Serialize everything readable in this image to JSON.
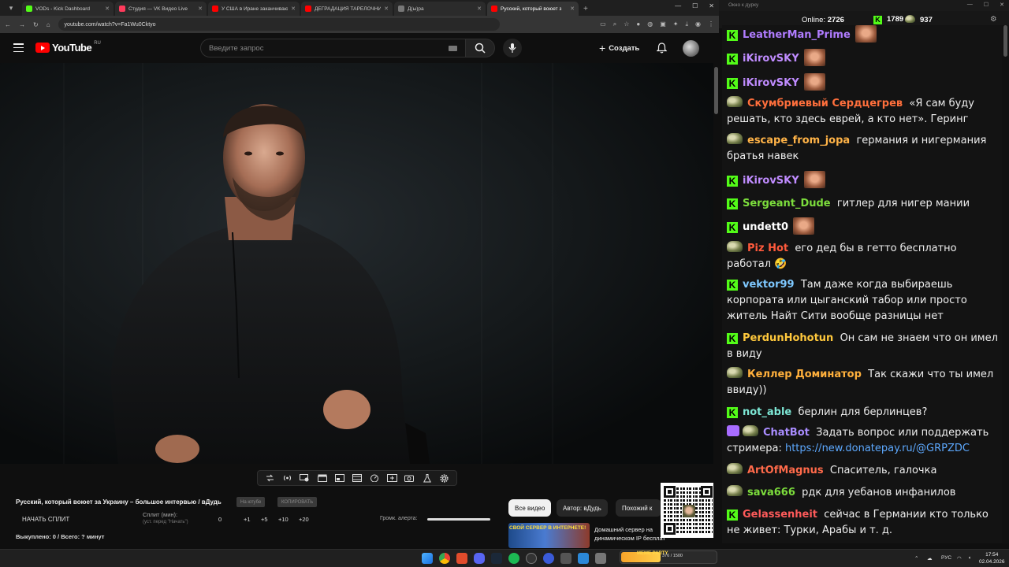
{
  "browser": {
    "tabs": [
      {
        "title": "VODs - Kick Dashboard",
        "color": "#53fc18"
      },
      {
        "title": "Студия — VK Видео Live",
        "color": "#ff3b5c"
      },
      {
        "title": "У США в Иране заканчиваютс",
        "color": "#ff0000"
      },
      {
        "title": "ДЕГРАДАЦИЯ ТАРЕЛОЧНИЦ",
        "color": "#ff0000"
      },
      {
        "title": "Д(ы)ра",
        "color": "#777777"
      },
      {
        "title": "Русский, который воюет з",
        "color": "#ff0000",
        "active": true
      }
    ],
    "url": "youtube.com/watch?v=Fa1Wu0Cktyo"
  },
  "youtube": {
    "logo_text": "YouTube",
    "region": "RU",
    "search_placeholder": "Введите запрос",
    "create_label": "Создать"
  },
  "video": {
    "title": "Русский, который воюет за Украину – большое интервью / вДудь",
    "chip_on_youtube": "На ютубе",
    "chip_copy": "КОПИРОВАТЬ",
    "split_start": "НАЧАТЬ СПЛИТ",
    "split_minutes_label": "Сплит (мин):",
    "split_minutes_hint": "(уст. перед \"Начать\")",
    "split_value": "0",
    "increments": [
      "+1",
      "+5",
      "+10",
      "+20"
    ],
    "bought": "Выкуплено: 0 / Всего: ? минут",
    "alert_volume_label": "Громк. алерта:"
  },
  "filters": [
    "Все видео",
    "Автор: вДудь",
    "Похожий к"
  ],
  "recommendation": {
    "thumb_text": "СВОЙ СЕРВЕР В ИНТЕРНЕТЕ!",
    "title_line1": "Домашний сервер на",
    "title_line2": "динамическом IP бесплатно!"
  },
  "chat_window": {
    "title": "Окно к дурку",
    "online_label": "Online:",
    "online_value": "2726",
    "kick_count": "1789",
    "other_count": "937"
  },
  "chat": [
    {
      "platform": "kick",
      "user": "LeatherMan_Prime",
      "color": "#b07cff",
      "text": "",
      "emote": true
    },
    {
      "platform": "kick",
      "user": "iKirovSKY",
      "color": "#c08cff",
      "text": "",
      "emote": true
    },
    {
      "platform": "kick",
      "user": "iKirovSKY",
      "color": "#c08cff",
      "text": "",
      "emote": true
    },
    {
      "platform": "other",
      "user": "Скумбриевый Сердцегрев",
      "color": "#ff6f3c",
      "text": "«Я сам буду решать, кто здесь еврей, а кто нет». Геринг"
    },
    {
      "platform": "other",
      "user": "escape_from_jopa",
      "color": "#ffb347",
      "text": "германия и нигермания братья навек"
    },
    {
      "platform": "kick",
      "user": "iKirovSKY",
      "color": "#c08cff",
      "text": "",
      "emote": true
    },
    {
      "platform": "kick",
      "user": "Sergeant_Dude",
      "color": "#7cdd3c",
      "text": "гитлер для нигер мании"
    },
    {
      "platform": "kick",
      "user": "undett0",
      "color": "#ffffff",
      "text": "",
      "emote": true
    },
    {
      "platform": "other",
      "user": "Piz Hot",
      "color": "#ff5a3c",
      "text": "его дед бы в гетто бесплатно работал 🤣"
    },
    {
      "platform": "kick",
      "user": "vektor99",
      "color": "#7ec8ff",
      "text": "Там даже когда выбираешь корпората или цыганский табор или просто житель Найт Сити вообще разницы нет"
    },
    {
      "platform": "kick",
      "user": "PerdunHohotun",
      "color": "#ffc83c",
      "text": "Он сам не знаем что он имел в виду"
    },
    {
      "platform": "other",
      "user": "Келлер Доминатор",
      "color": "#ffb03c",
      "text": "Так скажи что ты имел ввиду))"
    },
    {
      "platform": "kick",
      "user": "not_able",
      "color": "#7ee8d6",
      "text": "берлин для берлинцев?"
    },
    {
      "platform": "bot",
      "user": "ChatBot",
      "color": "#a98cff",
      "text": "Задать вопрос или поддержать стримера:",
      "link": "https://new.donatepay.ru/@GRPZDC"
    },
    {
      "platform": "other",
      "user": "ArtOfMagnus",
      "color": "#ff6a4a",
      "text": "Спаситель, галочка"
    },
    {
      "platform": "other",
      "user": "sava666",
      "color": "#7cdd3c",
      "text": "рдк для уебанов инфанилов"
    },
    {
      "platform": "kick",
      "user": "Gelassenheit",
      "color": "#ff5a5a",
      "text": "сейчас в Германии кто только не живет: Турки, Арабы и т. д."
    }
  ],
  "taskbar": {
    "widget_text": "MEME PARTY",
    "widget_count": "376 / 1500",
    "lang": "РУС",
    "time": "17:54",
    "date": "02.04.2026"
  }
}
